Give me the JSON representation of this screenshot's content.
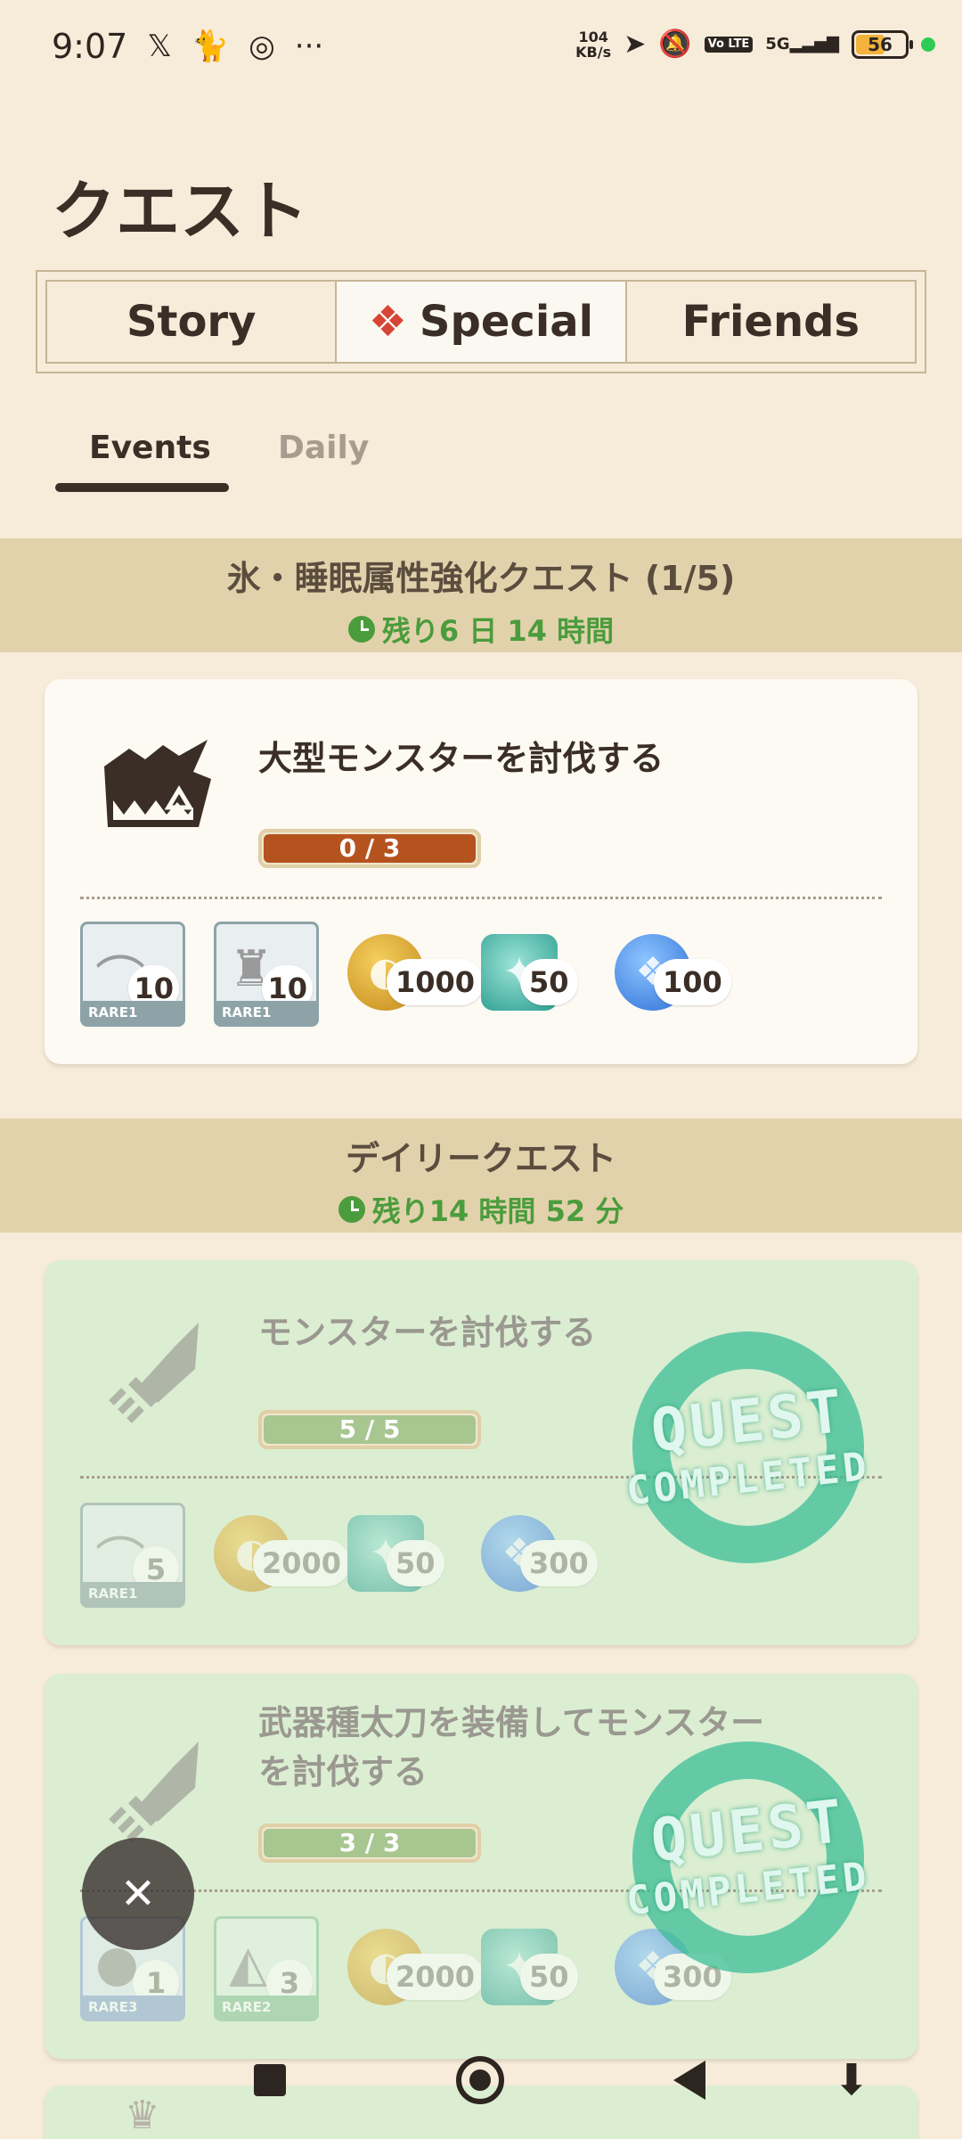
{
  "status_bar": {
    "time": "9:07",
    "left_icons": [
      "x-icon",
      "cat-icon",
      "ofi-icon"
    ],
    "more": "···",
    "net_speed_value": "104",
    "net_speed_unit": "KB/s",
    "volte": "Vo LTE",
    "signal": "5G",
    "battery": "56"
  },
  "page_title": "クエスト",
  "main_tabs": [
    {
      "label": "Story",
      "active": false
    },
    {
      "label": "Special",
      "active": true
    },
    {
      "label": "Friends",
      "active": false
    }
  ],
  "sub_tabs": {
    "events": "Events",
    "daily": "Daily",
    "active": "Events"
  },
  "sections": {
    "event": {
      "title": "氷・睡眠属性強化クエスト (1/5)",
      "timer": "残り6 日 14 時間"
    },
    "daily": {
      "title": "デイリークエスト",
      "timer": "残り14 時間 52 分"
    }
  },
  "quests": [
    {
      "title": "大型モンスターを討伐する",
      "progress_text": "0 / 3",
      "progress": 0,
      "completed": false,
      "items": [
        {
          "icon": "bone-icon",
          "qty": "10",
          "rarity": "RARE1"
        },
        {
          "icon": "monster-part-icon",
          "qty": "10",
          "rarity": "RARE1"
        }
      ],
      "currencies": [
        {
          "icon": "zenny-coin-icon",
          "amount": "1000"
        },
        {
          "icon": "gem-icon",
          "amount": "50"
        },
        {
          "icon": "blue-point-icon",
          "amount": "100"
        }
      ]
    },
    {
      "title": "モンスターを討伐する",
      "progress_text": "5 / 5",
      "progress": 1,
      "completed": true,
      "items": [
        {
          "icon": "bone-icon",
          "qty": "5",
          "rarity": "RARE1"
        }
      ],
      "currencies": [
        {
          "icon": "zenny-coin-icon",
          "amount": "2000"
        },
        {
          "icon": "gem-icon",
          "amount": "50"
        },
        {
          "icon": "blue-point-icon",
          "amount": "300"
        }
      ]
    },
    {
      "title_line1": "武器種太刀を装備してモンスター",
      "title_line2": "を討伐する",
      "progress_text": "3 / 3",
      "progress": 1,
      "completed": true,
      "items": [
        {
          "icon": "ore-icon",
          "qty": "1",
          "rarity": "RARE3"
        },
        {
          "icon": "armor-icon",
          "qty": "3",
          "rarity": "RARE2"
        }
      ],
      "currencies": [
        {
          "icon": "zenny-coin-icon",
          "amount": "2000"
        },
        {
          "icon": "gem-icon",
          "amount": "50"
        },
        {
          "icon": "blue-point-icon",
          "amount": "300"
        }
      ]
    }
  ],
  "stamp": {
    "line1": "QUEST",
    "line2": "COMPLETED"
  },
  "fab": {
    "icon": "close-icon",
    "glyph": "✕"
  },
  "colors": {
    "background": "#f6ecd9",
    "banner": "#e2d2ac",
    "timer_green": "#4b9c3c",
    "progress_orange": "#b5531f",
    "progress_green": "#a8c690",
    "completed_card": "#dbeed2",
    "special_red": "#d64535"
  }
}
